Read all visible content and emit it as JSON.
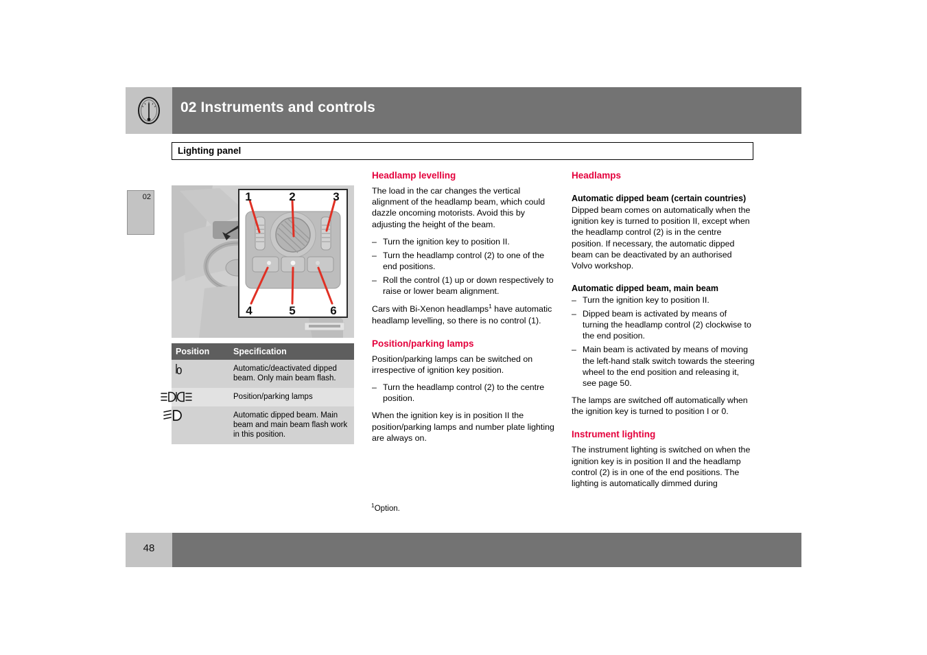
{
  "header": {
    "chapter_title": "02 Instruments and controls",
    "icon": "gauge-icon"
  },
  "section": {
    "title": "Lighting panel"
  },
  "side_tab": {
    "chapter_number": "02"
  },
  "illustration": {
    "callouts": [
      "1",
      "2",
      "3",
      "4",
      "5",
      "6"
    ],
    "watermark": ""
  },
  "spec_table": {
    "headers": [
      "Position",
      "Specification"
    ],
    "rows": [
      {
        "icon": "zero-position-icon",
        "icon_glyph": "0",
        "specification": "Automatic/deactivated dipped beam. Only main beam flash."
      },
      {
        "icon": "position-parking-lamps-icon",
        "icon_glyph": "",
        "specification": "Position/parking lamps"
      },
      {
        "icon": "dipped-beam-icon",
        "icon_glyph": "",
        "specification": "Automatic dipped beam. Main beam and main beam flash work in this position."
      }
    ]
  },
  "middle_column": {
    "headlamp_levelling": {
      "heading": "Headlamp levelling",
      "intro": "The load in the car changes the vertical alignment of the headlamp beam, which could dazzle oncoming motorists. Avoid this by adjusting the height of the beam.",
      "steps": [
        "Turn the ignition key to position II.",
        "Turn the headlamp control (2) to one of the end positions.",
        "Roll the control (1) up or down respectively to raise or lower beam alignment."
      ],
      "outro_prefix": "Cars with Bi-Xenon headlamps",
      "outro_footnote_marker": "1",
      "outro_suffix": " have automatic headlamp levelling, so there is no control (1)."
    },
    "position_parking_lamps": {
      "heading": "Position/parking lamps",
      "intro": "Position/parking lamps can be switched on irrespective of ignition key position.",
      "steps": [
        "Turn the headlamp control (2) to the centre position."
      ],
      "outro": "When the ignition key is in position II the position/parking lamps and number plate lighting are always on."
    }
  },
  "right_column": {
    "headlamps": {
      "heading": "Headlamps",
      "auto_dipped_beam": {
        "subheading": "Automatic dipped beam (certain countries)",
        "body": "Dipped beam comes on automatically when the ignition key is turned to position II, except when the headlamp control (2) is in the centre position. If necessary, the automatic dipped beam can be deactivated by an authorised Volvo workshop."
      },
      "auto_dipped_main_beam": {
        "subheading": "Automatic dipped beam, main beam",
        "steps": [
          "Turn the ignition key to position II.",
          "Dipped beam is activated by means of turning the headlamp control (2) clockwise to the end position.",
          "Main beam is activated by means of moving the left-hand stalk switch towards the steering wheel to the end position and releasing it, see page 50."
        ],
        "outro": "The lamps are switched off automatically when the ignition key is turned to position I or 0."
      }
    },
    "instrument_lighting": {
      "heading": "Instrument lighting",
      "body": "The instrument lighting is switched on when the ignition key is in position II and the headlamp control (2) is in one of the end positions. The lighting is automatically dimmed during"
    }
  },
  "footnote": {
    "marker": "1",
    "text": "Option."
  },
  "footer": {
    "page_number": "48"
  },
  "colors": {
    "accent_pink": "#e4003c",
    "header_gray": "#737373",
    "tab_gray": "#c3c3c3",
    "table_header_gray": "#5e5e5e"
  }
}
